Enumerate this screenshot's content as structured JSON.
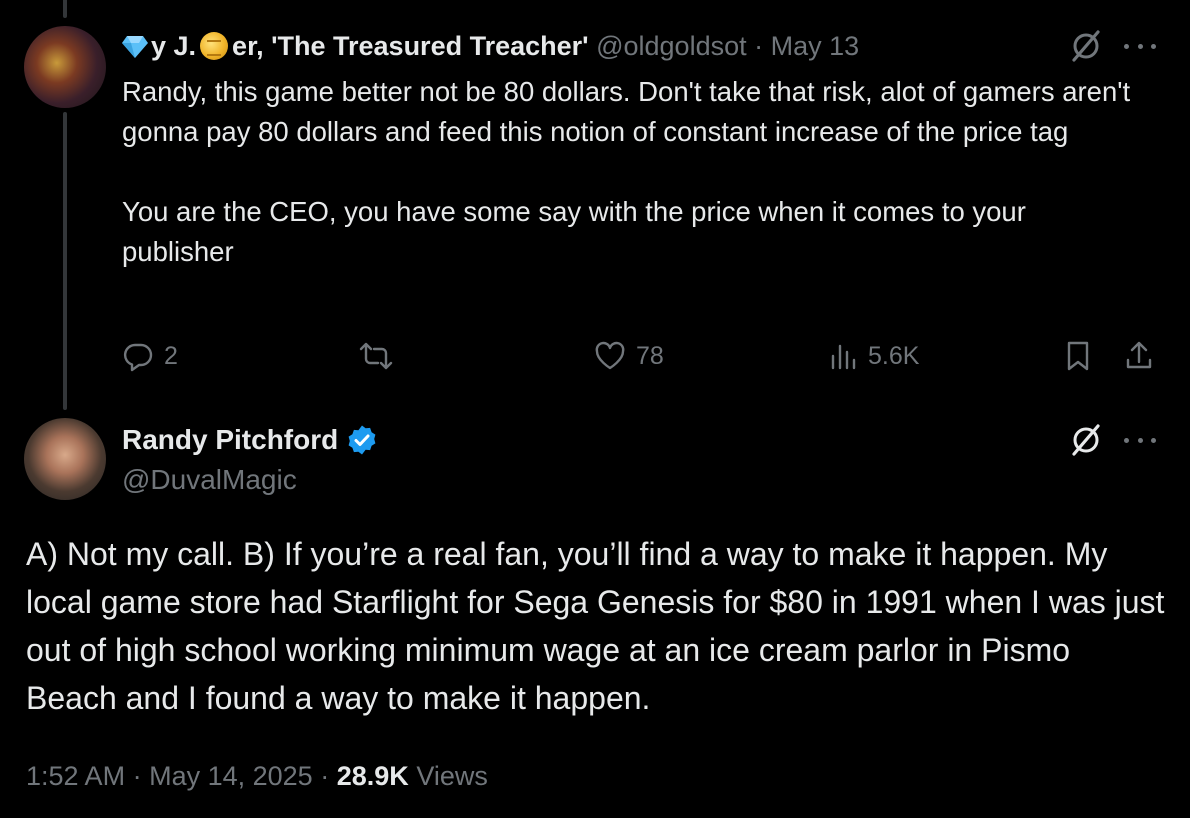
{
  "reply_tweet": {
    "display_name_part1": "y J.",
    "display_name_part2": "er, 'The Treasured Treacher'",
    "handle": "@oldgoldsot",
    "separator": "·",
    "date": "May 13",
    "text": "Randy, this game better not be 80 dollars. Don't take that risk, alot of gamers aren't gonna pay 80 dollars and feed this notion of constant increase of the price tag\n\nYou are the CEO, you have some say with the price when it comes to your publisher",
    "replies": "2",
    "retweets": "",
    "likes": "78",
    "views": "5.6K",
    "icons": [
      "reply-icon",
      "retweet-icon",
      "like-icon",
      "views-icon",
      "bookmark-icon",
      "share-icon",
      "grok-icon",
      "more-icon"
    ]
  },
  "main_tweet": {
    "display_name": "Randy Pitchford",
    "handle": "@DuvalMagic",
    "verified_color": "#1d9bf0",
    "text": "A) Not my call. B) If you’re a real fan, you’ll find a way to make it happen. My local game store had Starflight for Sega Genesis for $80 in 1991 when I was just out of high school working minimum wage at an ice cream parlor in Pismo Beach and I found a way to make it happen.",
    "time": "1:52 AM",
    "date": "May 14, 2025",
    "views_count": "28.9K",
    "views_label": "Views"
  },
  "colors": {
    "background": "#000000",
    "text": "#e7e9ea",
    "muted": "#71767b",
    "thread_line": "#333639"
  }
}
